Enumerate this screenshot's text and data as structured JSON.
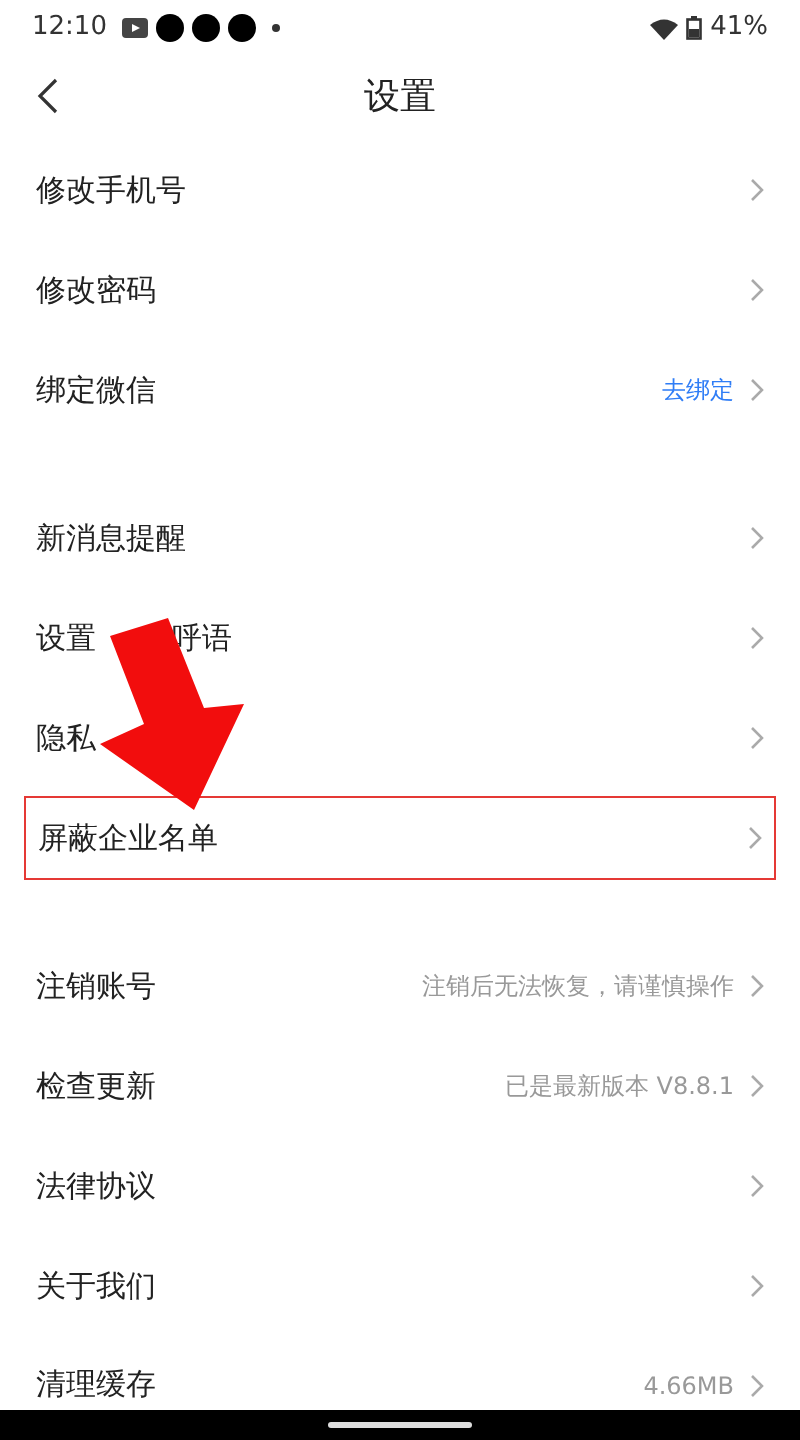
{
  "status_bar": {
    "time": "12:10",
    "battery": "41%"
  },
  "header": {
    "title": "设置"
  },
  "sections": [
    {
      "items": [
        {
          "label": "修改手机号"
        },
        {
          "label": "修改密码"
        },
        {
          "label": "绑定微信",
          "value": "去绑定",
          "value_is_link": true
        }
      ]
    },
    {
      "items": [
        {
          "label": "新消息提醒"
        },
        {
          "label": "设置",
          "label_tail": "呼语"
        },
        {
          "label": "隐私"
        },
        {
          "label": "屏蔽企业名单",
          "highlighted": true
        }
      ]
    },
    {
      "items": [
        {
          "label": "注销账号",
          "value": "注销后无法恢复，请谨慎操作",
          "value_is_link": false
        },
        {
          "label": "检查更新",
          "value": "已是最新版本 V8.8.1",
          "value_is_link": false
        },
        {
          "label": "法律协议"
        },
        {
          "label": "关于我们"
        },
        {
          "label": "清理缓存",
          "value": "4.66MB",
          "value_is_link": false
        }
      ]
    }
  ]
}
